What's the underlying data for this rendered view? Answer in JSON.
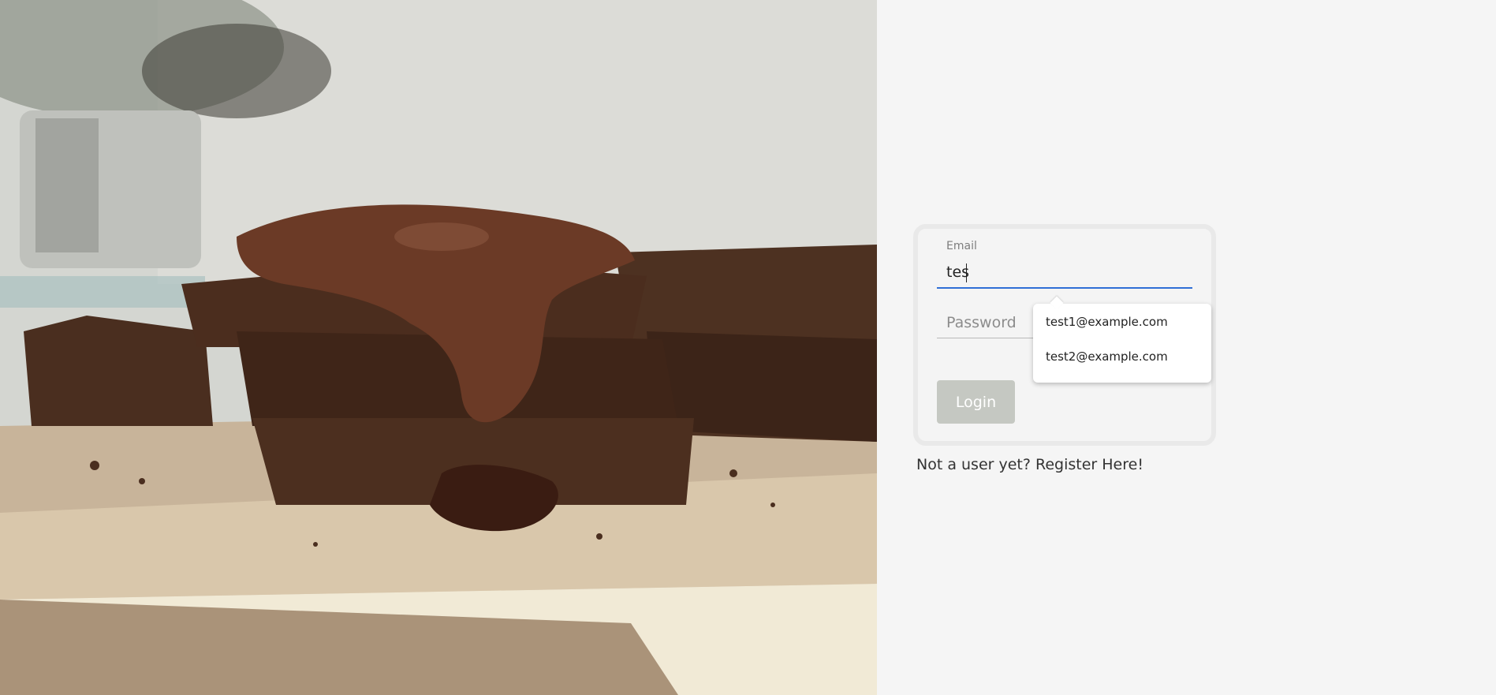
{
  "login": {
    "email_label": "Email",
    "email_value": "tes",
    "password_placeholder": "Password",
    "login_label": "Login"
  },
  "autocomplete": {
    "options": [
      "test1@example.com",
      "test2@example.com"
    ]
  },
  "register_text": "Not a user yet? Register Here!",
  "colors": {
    "page_background": "#f5f5f5",
    "email_underline": "#2f6fd6",
    "login_button": "#c5c8c2"
  }
}
